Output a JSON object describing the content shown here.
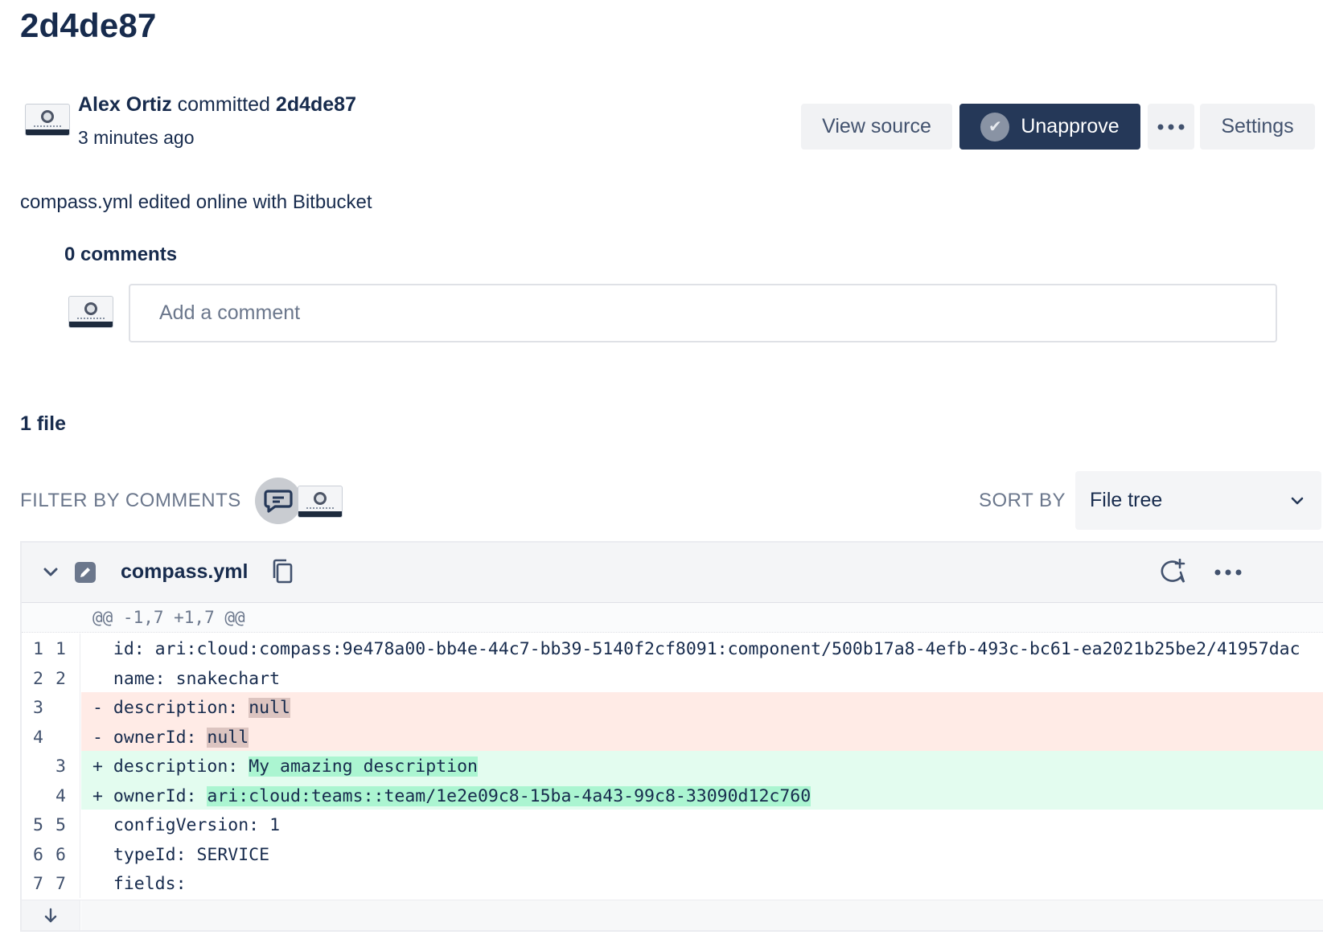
{
  "commit": {
    "title": "2d4de87",
    "author": "Alex Ortiz",
    "verb": "committed",
    "hash": "2d4de87",
    "time": "3 minutes ago",
    "message": "compass.yml edited online with Bitbucket"
  },
  "actions": {
    "view_source": "View source",
    "unapprove": "Unapprove",
    "settings": "Settings"
  },
  "comments": {
    "count_label": "0 comments",
    "placeholder": "Add a comment"
  },
  "files": {
    "count_label": "1 file",
    "filter_label": "FILTER BY COMMENTS",
    "sort_label": "SORT BY",
    "sort_value": "File tree"
  },
  "diff": {
    "filename": "compass.yml",
    "hunk": "@@ -1,7 +1,7 @@",
    "lines": [
      {
        "old": "1",
        "new": "1",
        "type": "ctx",
        "marker": " ",
        "prefix": "id: ari:cloud:compass:9e478a00-bb4e-44c7-bb39-5140f2cf8091:component/500b17a8-4efb-493c-bc61-ea2021b25be2/41957dac",
        "hl": "",
        "suffix": ""
      },
      {
        "old": "2",
        "new": "2",
        "type": "ctx",
        "marker": " ",
        "prefix": "name: snakechart",
        "hl": "",
        "suffix": ""
      },
      {
        "old": "3",
        "new": "",
        "type": "del",
        "marker": "-",
        "prefix": "description: ",
        "hl": "null",
        "suffix": ""
      },
      {
        "old": "4",
        "new": "",
        "type": "del",
        "marker": "-",
        "prefix": "ownerId: ",
        "hl": "null",
        "suffix": ""
      },
      {
        "old": "",
        "new": "3",
        "type": "add",
        "marker": "+",
        "prefix": "description: ",
        "hl": "My amazing description",
        "suffix": ""
      },
      {
        "old": "",
        "new": "4",
        "type": "add",
        "marker": "+",
        "prefix": "ownerId: ",
        "hl": "ari:cloud:teams::team/1e2e09c8-15ba-4a43-99c8-33090d12c760",
        "suffix": ""
      },
      {
        "old": "5",
        "new": "5",
        "type": "ctx",
        "marker": " ",
        "prefix": "configVersion: 1",
        "hl": "",
        "suffix": ""
      },
      {
        "old": "6",
        "new": "6",
        "type": "ctx",
        "marker": " ",
        "prefix": "typeId: SERVICE",
        "hl": "",
        "suffix": ""
      },
      {
        "old": "7",
        "new": "7",
        "type": "ctx",
        "marker": " ",
        "prefix": "fields:",
        "hl": "",
        "suffix": ""
      }
    ]
  },
  "icons": {
    "collapse": "chevron-down-icon",
    "file_modified": "edit-file-icon",
    "copy": "copy-icon",
    "add_comment": "add-comment-icon",
    "more": "more-icon",
    "expand": "arrow-down-icon",
    "filter_comments": "comment-filter-icon"
  },
  "colors": {
    "primary": "#253858",
    "deleted_bg": "#ffebe6",
    "added_bg": "#e3fcef",
    "added_highlight": "#abf5d1"
  }
}
